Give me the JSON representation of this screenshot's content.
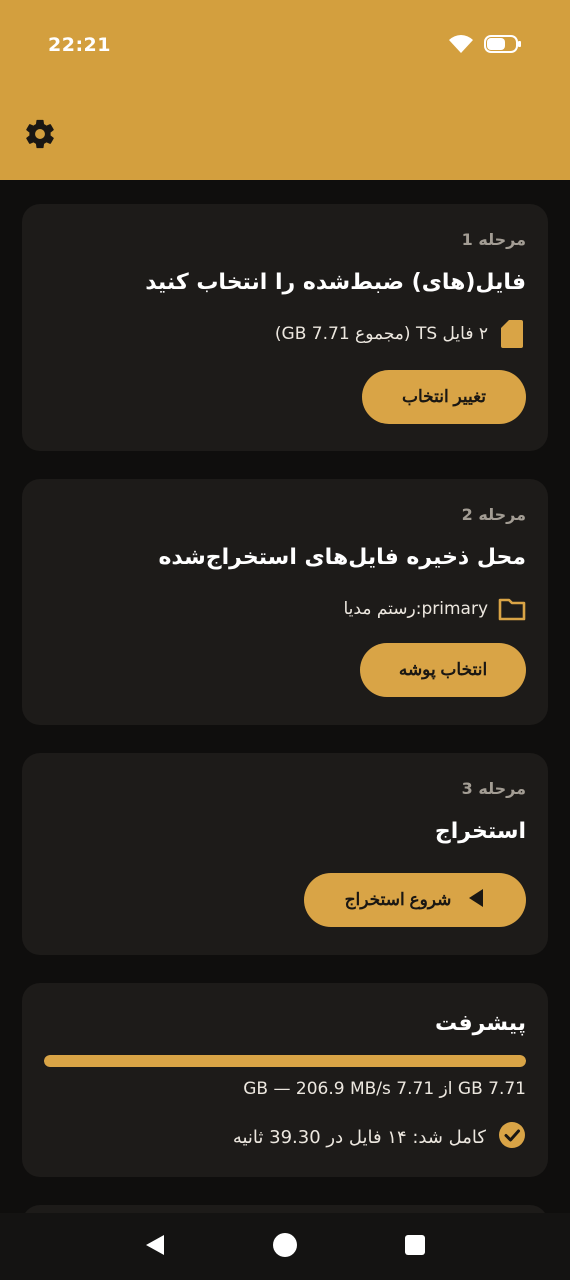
{
  "status_bar": {
    "time": "22:21"
  },
  "header": {
    "settings_icon": "gear-icon"
  },
  "steps": [
    {
      "step_label": "مرحله 1",
      "title": "فایل(های) ضبط‌شده را انتخاب کنید",
      "info_icon": "file-icon",
      "info_text": "۲ فایل TS (مجموع 7.71 GB)",
      "button_label": "تغییر انتخاب"
    },
    {
      "step_label": "مرحله 2",
      "title": "محل ذخیره فایل‌های استخراج‌شده",
      "info_icon": "folder-icon",
      "info_text": "primary:رستم مدیا",
      "button_label": "انتخاب پوشه"
    },
    {
      "step_label": "مرحله 3",
      "title": "استخراج",
      "button_icon": "play-icon",
      "button_label": "شروع استخراج"
    }
  ],
  "progress": {
    "title": "پیشرفت",
    "fraction": 1.0,
    "stats_text": "7.71 GB از 7.71 GB — 206.9 MB/s",
    "complete_icon": "check-circle-icon",
    "complete_text": "کامل شد: ۱۴ فایل در 39.30 ثانیه"
  },
  "colors": {
    "accent": "#d9a446",
    "header": "#d39f3e",
    "card": "#1d1b19",
    "background": "#0f0e0d"
  }
}
